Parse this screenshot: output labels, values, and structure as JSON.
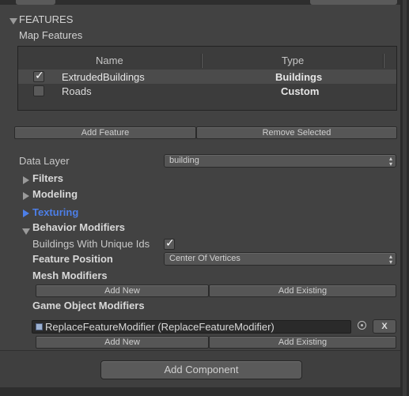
{
  "section": {
    "title": "FEATURES",
    "map_features_label": "Map Features"
  },
  "table": {
    "headers": [
      "Name",
      "Type"
    ],
    "rows": [
      {
        "name": "ExtrudedBuildings",
        "type": "Buildings",
        "checked": true
      },
      {
        "name": "Roads",
        "type": "Custom",
        "checked": false
      }
    ]
  },
  "buttons": {
    "add_feature": "Add Feature",
    "remove_selected": "Remove Selected",
    "add_new": "Add New",
    "add_existing": "Add Existing",
    "x": "X",
    "add_component": "Add Component"
  },
  "data_layer": {
    "label": "Data Layer",
    "value": "building"
  },
  "foldouts": {
    "filters": "Filters",
    "modeling": "Modeling",
    "texturing": "Texturing",
    "behavior_modifiers": "Behavior Modifiers"
  },
  "behavior": {
    "unique_ids_label": "Buildings With Unique Ids",
    "unique_ids_checked": true,
    "feature_position_label": "Feature Position",
    "feature_position_value": "Center Of Vertices",
    "mesh_modifiers_label": "Mesh Modifiers",
    "game_object_modifiers_label": "Game Object Modifiers",
    "game_object_modifier_value": "ReplaceFeatureModifier (ReplaceFeatureModifier)"
  },
  "icons": {
    "checkmark": "check-icon",
    "dropdown": "updown-arrows-icon",
    "object": "script-icon",
    "target": "object-picker-icon"
  },
  "colors": {
    "background": "#424242",
    "accent_blue": "#4d7fe8",
    "text": "#c8c8c8"
  }
}
